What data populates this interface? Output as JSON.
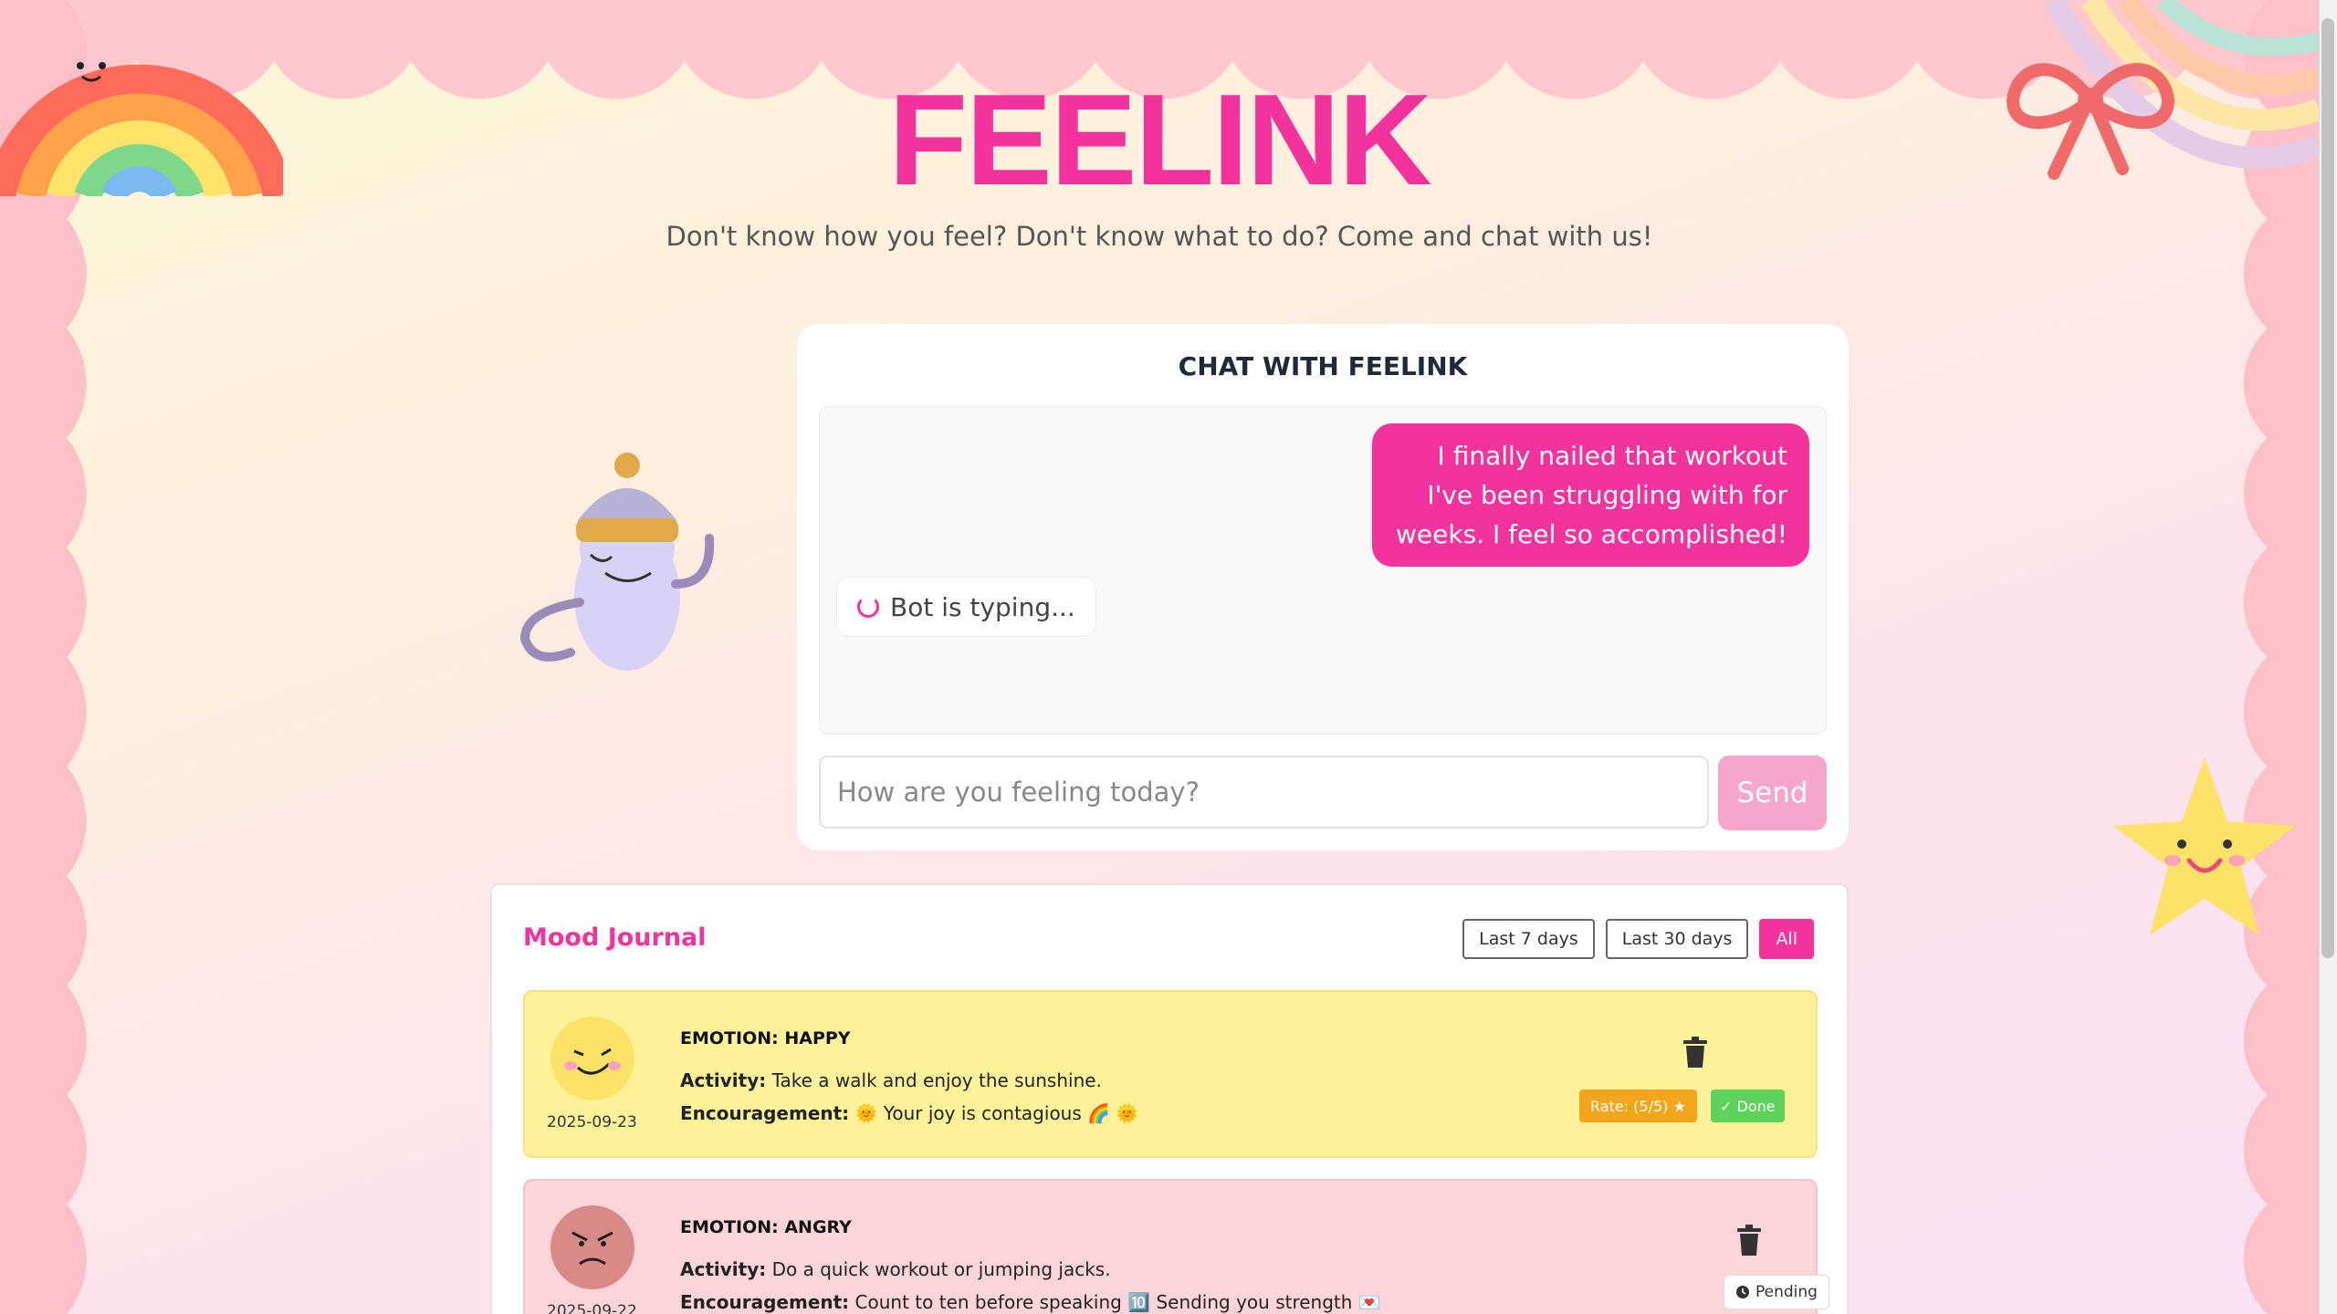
{
  "app": {
    "title": "FEELINK",
    "subtitle": "Don't know how you feel? Don't know what to do? Come and chat with us!"
  },
  "chat": {
    "heading": "CHAT WITH FEELINK",
    "user_message": "I finally nailed that workout I've been struggling with for weeks. I feel so accomplished!",
    "typing_text": "Bot is typing...",
    "input_placeholder": "How are you feeling today?",
    "input_value": "",
    "send_label": "Send"
  },
  "journal": {
    "title": "Mood Journal",
    "filters": [
      "Last 7 days",
      "Last 30 days",
      "All"
    ],
    "active_filter": "All",
    "entries": [
      {
        "emotion": "EMOTION: HAPPY",
        "activity_label": "Activity:",
        "activity": "Take a walk and enjoy the sunshine.",
        "encouragement_label": "Encouragement:",
        "encouragement": "🌞 Your joy is contagious 🌈 🌞",
        "date": "2025-09-23",
        "rate_label": "Rate: (5/5) ★",
        "status_label": "✓ Done"
      },
      {
        "emotion": "EMOTION: ANGRY",
        "activity_label": "Activity:",
        "activity": "Do a quick workout or jumping jacks.",
        "encouragement_label": "Encouragement:",
        "encouragement": "Count to ten before speaking 🔟 Sending you strength 💌",
        "date": "2025-09-22",
        "status_label": "Pending"
      }
    ]
  },
  "colors": {
    "brand_pink": "#f2339e",
    "send_disabled": "#f6a5cc",
    "happy_bg": "#fdf29a",
    "angry_bg": "#fdd5d9",
    "rate_orange": "#f3a51b",
    "done_green": "#5dd35c"
  },
  "icons": [
    "rainbow-icon",
    "bow-icon",
    "star-icon",
    "ghost-mascot-icon",
    "spinner-icon",
    "trash-icon",
    "clock-icon",
    "happy-face-icon",
    "angry-face-icon"
  ]
}
